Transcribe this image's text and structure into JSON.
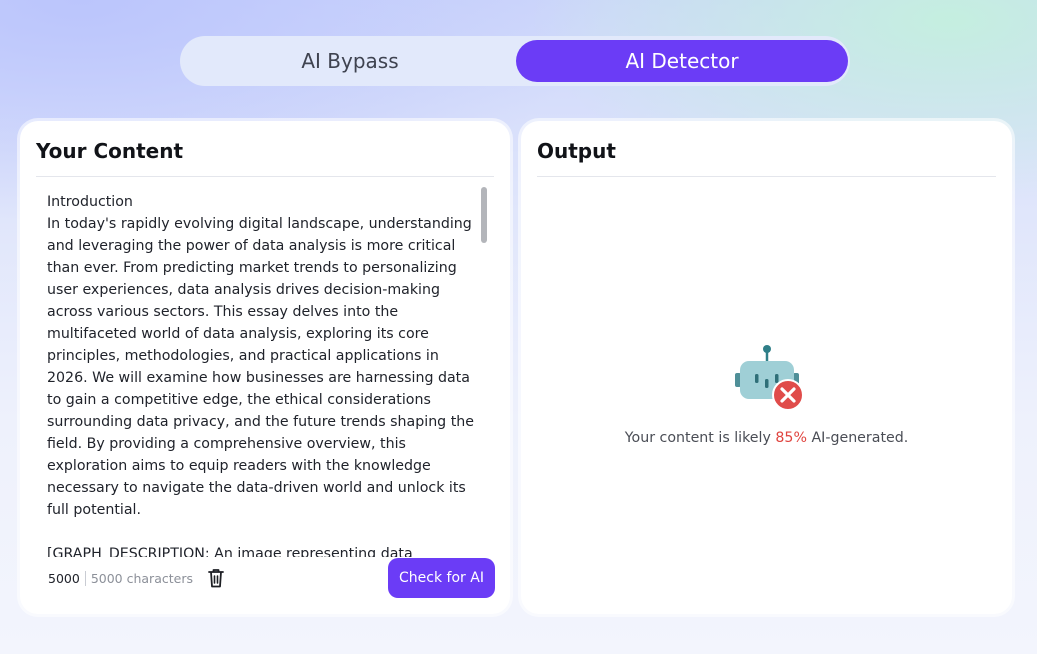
{
  "tabs": {
    "bypass_label": "AI Bypass",
    "detector_label": "AI Detector",
    "active": "AI Detector"
  },
  "input_panel": {
    "title": "Your Content",
    "paragraphs": [
      "Introduction\nIn today's rapidly evolving digital landscape, understanding and leveraging the power of data analysis is more critical than ever. From predicting market trends to personalizing user experiences, data analysis drives decision-making across various sectors. This essay delves into the multifaceted world of data analysis, exploring its core principles, methodologies, and practical applications in 2026. We will examine how businesses are harnessing data to gain a competitive edge, the ethical considerations surrounding data privacy, and the future trends shaping the field. By providing a comprehensive overview, this exploration aims to equip readers with the knowledge necessary to navigate the data-driven world and unlock its full potential.",
      "[GRAPH_DESCRIPTION: An image representing data analysis,"
    ],
    "char_count": "5000",
    "char_limit": "5000 characters",
    "check_button": "Check for AI",
    "trash_icon": "trash-icon"
  },
  "output_panel": {
    "title": "Output",
    "result_prefix": "Your content is likely ",
    "result_percent": "85%",
    "result_suffix": " AI-generated.",
    "robot_icon": "robot-x-icon"
  },
  "colors": {
    "accent": "#6b3cf6",
    "alert": "#e0443f",
    "robot_body": "#9fcfd6"
  }
}
